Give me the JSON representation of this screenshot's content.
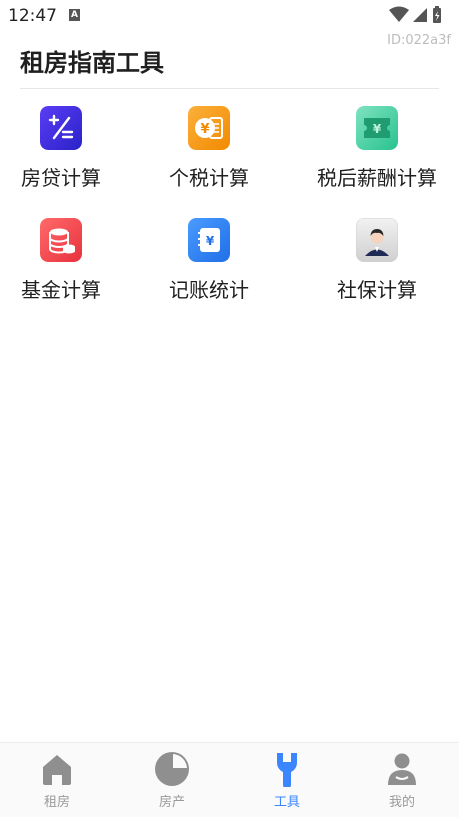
{
  "status_bar": {
    "time": "12:47",
    "notification_glyph": "A"
  },
  "id_text": "ID:022a3f",
  "page_title": "租房指南工具",
  "tools": [
    {
      "label": "房贷计算",
      "icon": "calculator-icon",
      "color": "#3a2ee0"
    },
    {
      "label": "个税计算",
      "icon": "tax-coin-icon",
      "color": "#f59a0b"
    },
    {
      "label": "税后薪酬计算",
      "icon": "salary-ticket-icon",
      "color": "#2fc99a"
    },
    {
      "label": "基金计算",
      "icon": "coin-stack-icon",
      "color": "#f24b55"
    },
    {
      "label": "记账统计",
      "icon": "ledger-icon",
      "color": "#2d7cf0"
    },
    {
      "label": "社保计算",
      "icon": "person-icon",
      "color": "#d9d9d9"
    }
  ],
  "bottom_nav": [
    {
      "label": "租房",
      "icon": "home-icon",
      "active": false
    },
    {
      "label": "房产",
      "icon": "pie-chart-icon",
      "active": false
    },
    {
      "label": "工具",
      "icon": "wrench-icon",
      "active": true
    },
    {
      "label": "我的",
      "icon": "user-icon",
      "active": false
    }
  ],
  "colors": {
    "accent": "#3b86ff",
    "inactive": "#9a9a9a"
  }
}
